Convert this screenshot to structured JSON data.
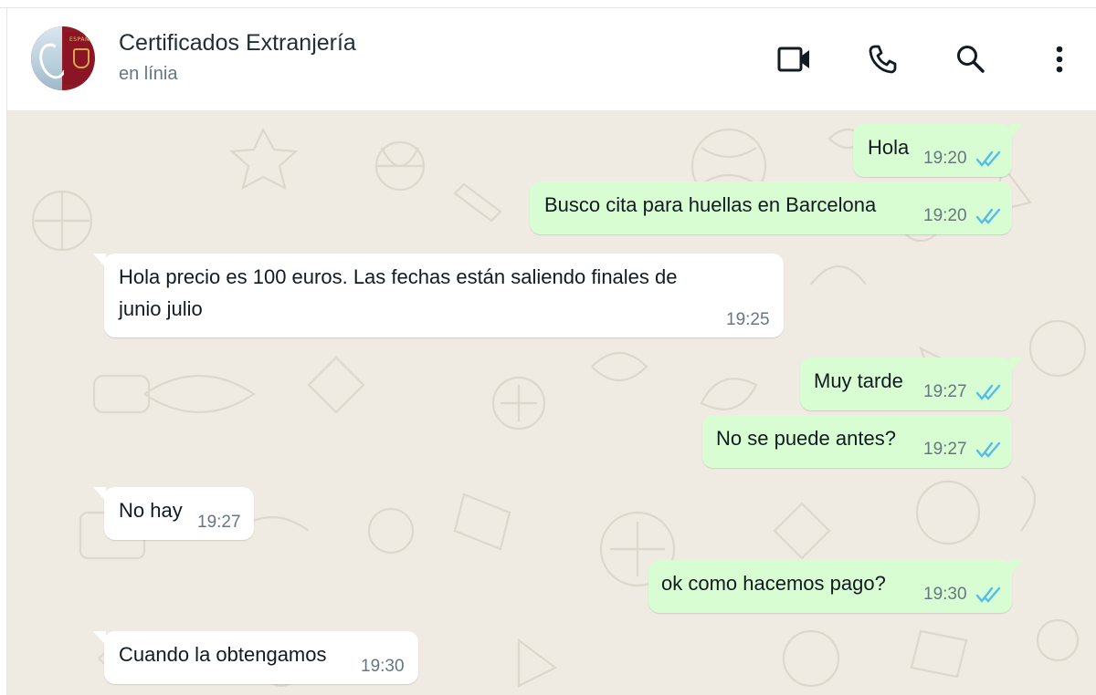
{
  "header": {
    "contact_name": "Certificados Extranjería",
    "status": "en línia",
    "avatar_label": "ESPAÑA"
  },
  "icons": {
    "video": "video-call-icon",
    "phone": "voice-call-icon",
    "search": "search-icon",
    "menu": "more-options-icon",
    "read_receipt": "double-check-read-icon"
  },
  "colors": {
    "outgoing_bubble": "#d9fdd3",
    "incoming_bubble": "#ffffff",
    "chat_background": "#efeae2",
    "read_tick": "#53bdeb"
  },
  "messages": [
    {
      "direction": "out",
      "text": "Hola",
      "time": "19:20",
      "status": "read"
    },
    {
      "direction": "out",
      "text": "Busco cita para huellas en Barcelona",
      "time": "19:20",
      "status": "read"
    },
    {
      "direction": "in",
      "text_line1": "Hola precio es 100 euros. Las fechas están saliendo finales de",
      "text_line2": "junio julio",
      "time": "19:25"
    },
    {
      "direction": "out",
      "text": "Muy tarde",
      "time": "19:27",
      "status": "read"
    },
    {
      "direction": "out",
      "text": "No se puede antes?",
      "time": "19:27",
      "status": "read"
    },
    {
      "direction": "in",
      "text": "No hay",
      "time": "19:27"
    },
    {
      "direction": "out",
      "text": "ok como hacemos pago?",
      "time": "19:30",
      "status": "read"
    },
    {
      "direction": "in",
      "text": "Cuando la obtengamos",
      "time": "19:30"
    }
  ]
}
